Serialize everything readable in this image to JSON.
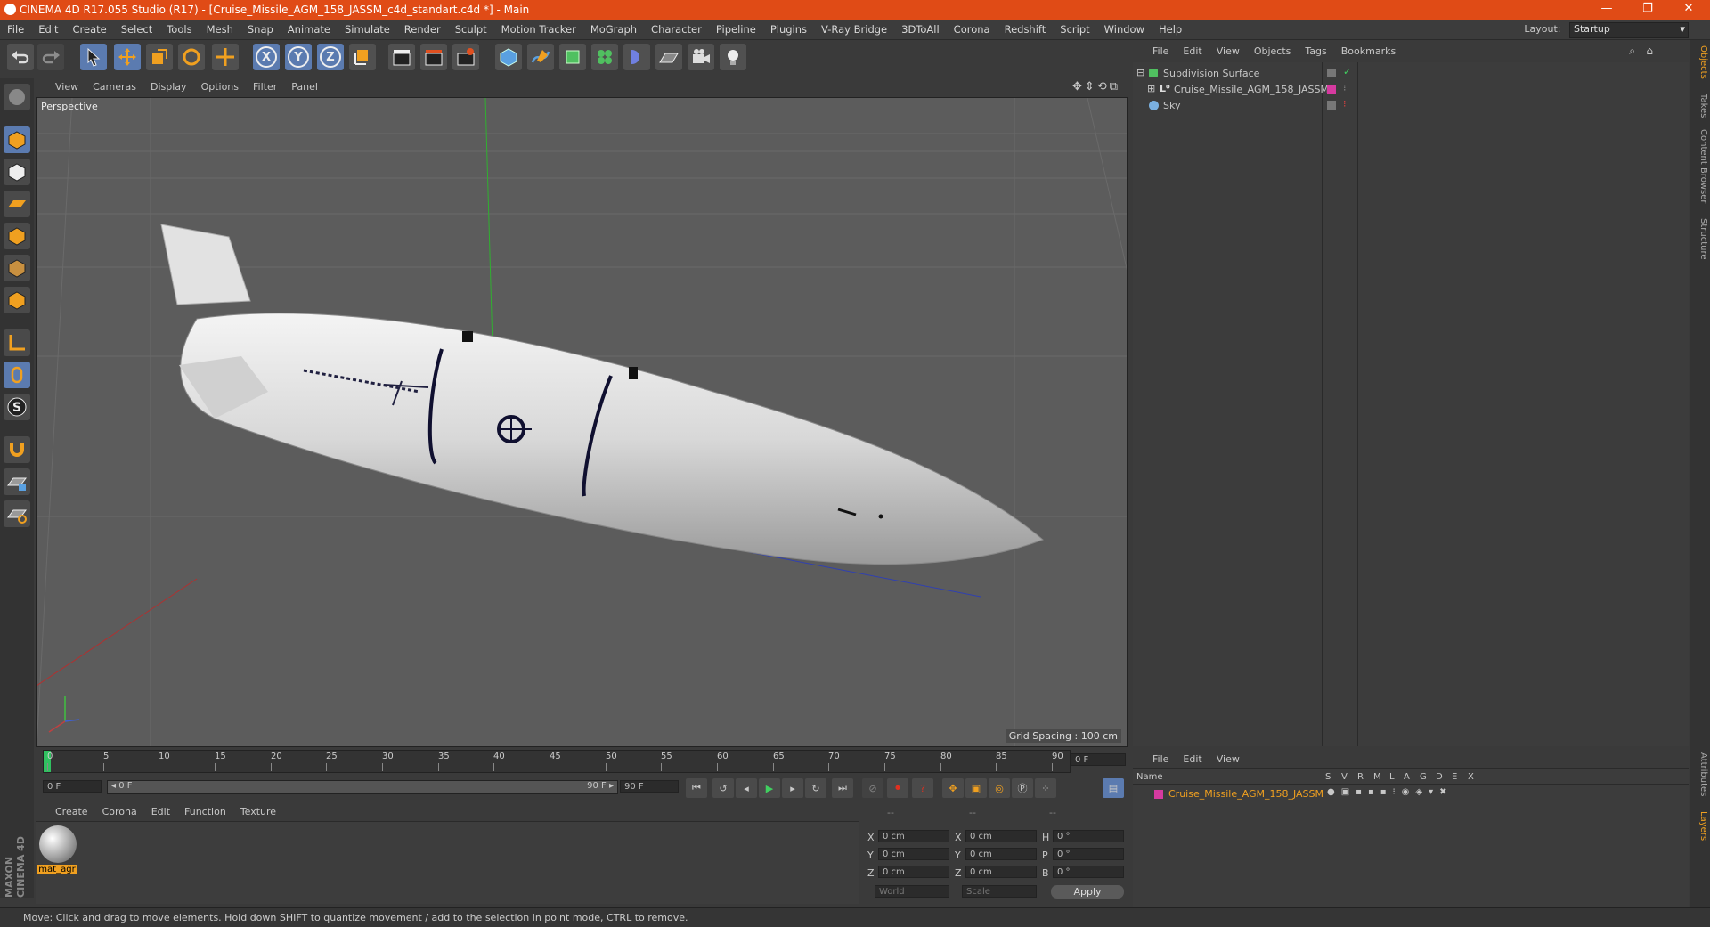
{
  "window": {
    "title": "CINEMA 4D R17.055 Studio (R17) - [Cruise_Missile_AGM_158_JASSM_c4d_standart.c4d *] - Main",
    "minimize": "—",
    "maximize": "❐",
    "close": "✕"
  },
  "menu": [
    "File",
    "Edit",
    "Create",
    "Select",
    "Tools",
    "Mesh",
    "Snap",
    "Animate",
    "Simulate",
    "Render",
    "Sculpt",
    "Motion Tracker",
    "MoGraph",
    "Character",
    "Pipeline",
    "Plugins",
    "V-Ray Bridge",
    "3DToAll",
    "Corona",
    "Redshift",
    "Script",
    "Window",
    "Help"
  ],
  "layout": {
    "label": "Layout:",
    "value": "Startup"
  },
  "toolbar": {
    "x_label": "X",
    "y_label": "Y",
    "z_label": "Z"
  },
  "viewport": {
    "menu": [
      "View",
      "Cameras",
      "Display",
      "Options",
      "Filter",
      "Panel"
    ],
    "camera_label": "Perspective",
    "grid_spacing": "Grid Spacing : 100 cm"
  },
  "timeline": {
    "ticks": [
      "0",
      "5",
      "10",
      "15",
      "20",
      "25",
      "30",
      "35",
      "40",
      "45",
      "50",
      "55",
      "60",
      "65",
      "70",
      "75",
      "80",
      "85",
      "90"
    ],
    "current_frame": "0 F",
    "start_field": "0 F",
    "range_start": "◂ 0 F",
    "range_end": "90 F ▸",
    "end_field": "90 F"
  },
  "material_manager": {
    "menu": [
      "Create",
      "Corona",
      "Edit",
      "Function",
      "Texture"
    ],
    "material_name": "mat_agr"
  },
  "coordinates": {
    "headers": [
      "--",
      "--",
      "--"
    ],
    "rows": [
      {
        "a": "X",
        "av": "0 cm",
        "b": "X",
        "bv": "0 cm",
        "c": "H",
        "cv": "0 °"
      },
      {
        "a": "Y",
        "av": "0 cm",
        "b": "Y",
        "bv": "0 cm",
        "c": "P",
        "cv": "0 °"
      },
      {
        "a": "Z",
        "av": "0 cm",
        "b": "Z",
        "bv": "0 cm",
        "c": "B",
        "cv": "0 °"
      }
    ],
    "world": "World",
    "scale": "Scale",
    "apply": "Apply"
  },
  "object_manager": {
    "menu": [
      "File",
      "Edit",
      "View",
      "Objects",
      "Tags",
      "Bookmarks"
    ],
    "objects": [
      {
        "name": "Subdivision Surface"
      },
      {
        "name": "Cruise_Missile_AGM_158_JASSM"
      },
      {
        "name": "Sky"
      }
    ]
  },
  "layer_manager": {
    "menu": [
      "File",
      "Edit",
      "View"
    ],
    "columns": [
      "Name",
      "S",
      "V",
      "R",
      "M",
      "L",
      "A",
      "G",
      "D",
      "E",
      "X"
    ],
    "layer_name": "Cruise_Missile_AGM_158_JASSM",
    "layer_color": "#d63aa0"
  },
  "right_tabs": [
    "Objects",
    "Takes",
    "Content Browser",
    "Structure",
    "Attributes",
    "Layers"
  ],
  "brand": "MAXON CINEMA 4D",
  "status": "Move: Click and drag to move elements. Hold down SHIFT to quantize movement / add to the selection in point mode, CTRL to remove.",
  "colors": {
    "titlebar": "#e04b16",
    "active_tool": "#5b7bb0",
    "accent_orange": "#f0a020"
  }
}
